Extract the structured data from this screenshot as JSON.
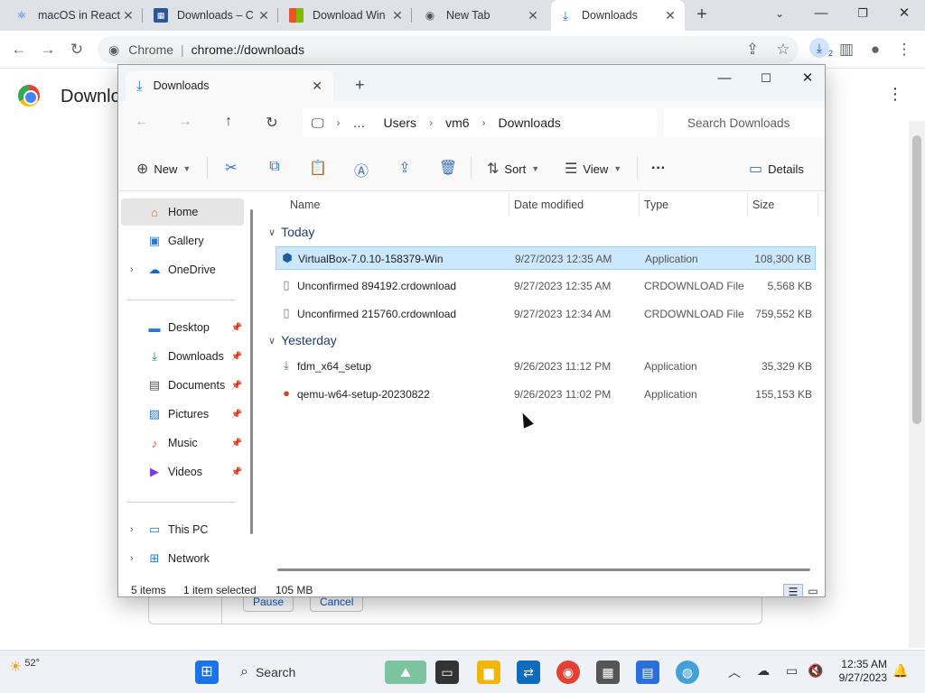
{
  "chrome": {
    "tabs": [
      {
        "title": "macOS in React",
        "icon": "react-favicon"
      },
      {
        "title": "Downloads – C",
        "icon": "site-favicon"
      },
      {
        "title": "Download Win",
        "icon": "microsoft-favicon"
      },
      {
        "title": "New Tab",
        "icon": "chrome-favicon"
      },
      {
        "title": "Downloads",
        "icon": "download-favicon"
      }
    ],
    "omnibox_site": "Chrome",
    "omnibox_url": "chrome://downloads",
    "download_count": "2"
  },
  "page": {
    "title": "Downloads",
    "pause_label": "Pause",
    "cancel_label": "Cancel"
  },
  "explorer": {
    "tab_title": "Downloads",
    "breadcrumb": [
      "…",
      "Users",
      "vm6",
      "Downloads"
    ],
    "search_placeholder": "Search Downloads",
    "cmd": {
      "new_label": "New",
      "sort_label": "Sort",
      "view_label": "View",
      "more_label": "···",
      "details_label": "Details"
    },
    "sidebar": {
      "home": "Home",
      "gallery": "Gallery",
      "onedrive": "OneDrive",
      "desktop": "Desktop",
      "downloads": "Downloads",
      "documents": "Documents",
      "pictures": "Pictures",
      "music": "Music",
      "videos": "Videos",
      "thispc": "This PC",
      "network": "Network"
    },
    "columns": {
      "name": "Name",
      "date": "Date modified",
      "type": "Type",
      "size": "Size"
    },
    "groups": {
      "today": "Today",
      "yesterday": "Yesterday"
    },
    "files": [
      {
        "name": "VirtualBox-7.0.10-158379-Win",
        "date": "9/27/2023 12:35 AM",
        "type": "Application",
        "size": "108,300 KB"
      },
      {
        "name": "Unconfirmed 894192.crdownload",
        "date": "9/27/2023 12:35 AM",
        "type": "CRDOWNLOAD File",
        "size": "5,568 KB"
      },
      {
        "name": "Unconfirmed 215760.crdownload",
        "date": "9/27/2023 12:34 AM",
        "type": "CRDOWNLOAD File",
        "size": "759,552 KB"
      },
      {
        "name": "fdm_x64_setup",
        "date": "9/26/2023 11:12 PM",
        "type": "Application",
        "size": "35,329 KB"
      },
      {
        "name": "qemu-w64-setup-20230822",
        "date": "9/26/2023 11:02 PM",
        "type": "Application",
        "size": "155,153 KB"
      }
    ],
    "status": {
      "items": "5 items",
      "selected": "1 item selected",
      "size": "105 MB"
    }
  },
  "taskbar": {
    "temp": "52°",
    "search": "Search",
    "time": "12:35 AM",
    "date": "9/27/2023"
  }
}
